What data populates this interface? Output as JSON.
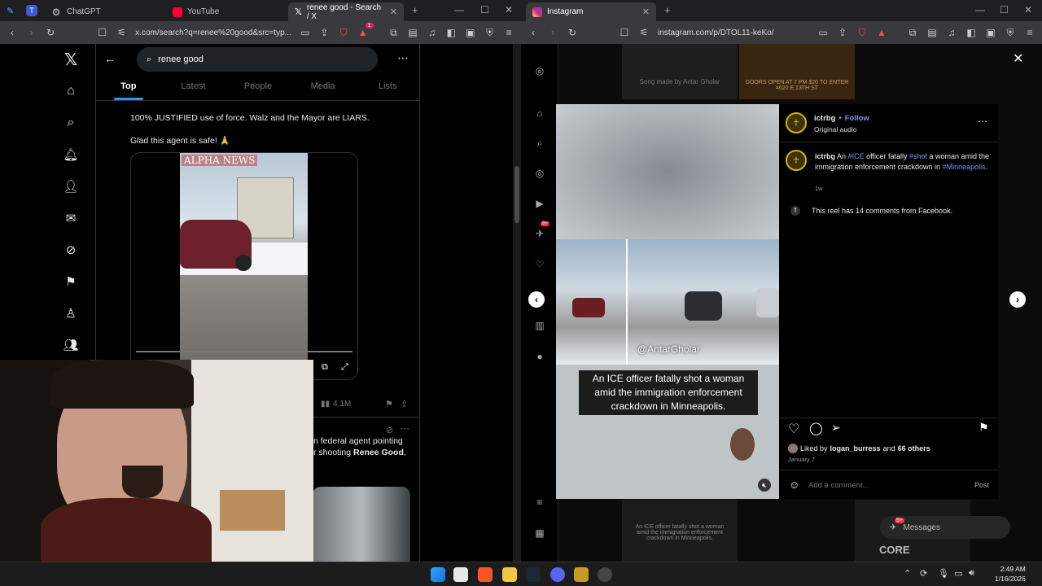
{
  "left_browser": {
    "tabs": [
      {
        "label": "ChatGPT",
        "active": false
      },
      {
        "label": "YouTube",
        "active": false
      },
      {
        "label": "renee good - Search / X",
        "active": true
      }
    ],
    "url": "x.com/search?q=renee%20good&src=typ...",
    "badge_count": "1"
  },
  "x": {
    "search_query": "renee good",
    "tabs": [
      "Top",
      "Latest",
      "People",
      "Media",
      "Lists"
    ],
    "tweet": {
      "line1": "100% JUSTIFIED use of force. Walz and the Mayor are LIARS.",
      "line2": "Glad this agent is safe! 🙏",
      "video_watermark": "ALPHA NEWS",
      "views": "4.1M"
    },
    "tweet2": {
      "line1": "n federal agent pointing",
      "line2_pre": "r shooting ",
      "line2_bold": "Renee Good",
      "line2_post": ","
    }
  },
  "right_browser": {
    "tab": "Instagram",
    "url": "instagram.com/p/DTOL11-keKo/"
  },
  "instagram": {
    "bg_caption": "Song made by Antar Gholar",
    "bg_poster": "DOORS OPEN AT 7 PM $20 TO ENTER 4620 E 13TH ST",
    "username": "ictrbg",
    "follow": "Follow",
    "audio": "Original audio",
    "caption_user": "ictrbg",
    "caption_pre": "An",
    "caption_tag1": "#ICE",
    "caption_mid": "officer fatally",
    "caption_tag2": "#shot",
    "caption_post": "a woman amid the immigration enforcement crackdown in",
    "caption_tag3": "#Minneapolis",
    "caption_end": ".",
    "caption_age": "1w",
    "facebook_note": "This reel has 14 comments from Facebook.",
    "reel_handle": "@AntarGholar",
    "reel_caption": "An ICE officer fatally shot a woman amid the immigration enforcement crackdown in Minneapolis.",
    "liked_pre": "Liked by",
    "liked_user": "logan_burress",
    "liked_mid": "and",
    "liked_count": "66 others",
    "date": "January 7",
    "comment_placeholder": "Add a comment...",
    "post": "Post",
    "messages": "Messages",
    "messages_badge": "9+",
    "bg_bottom_caption": "An ICE officer fatally shot a woman amid the immigration enforcement crackdown in Minneapolis.",
    "bg_bottom_text": "CORE",
    "sidebar_badge": "9+"
  },
  "taskbar": {
    "time": "2:49 AM",
    "date": "1/16/2026"
  },
  "colors": {
    "x_blue": "#1d9bf0",
    "ig_link": "#7d8ff0",
    "brave_orange": "#fb542b"
  }
}
